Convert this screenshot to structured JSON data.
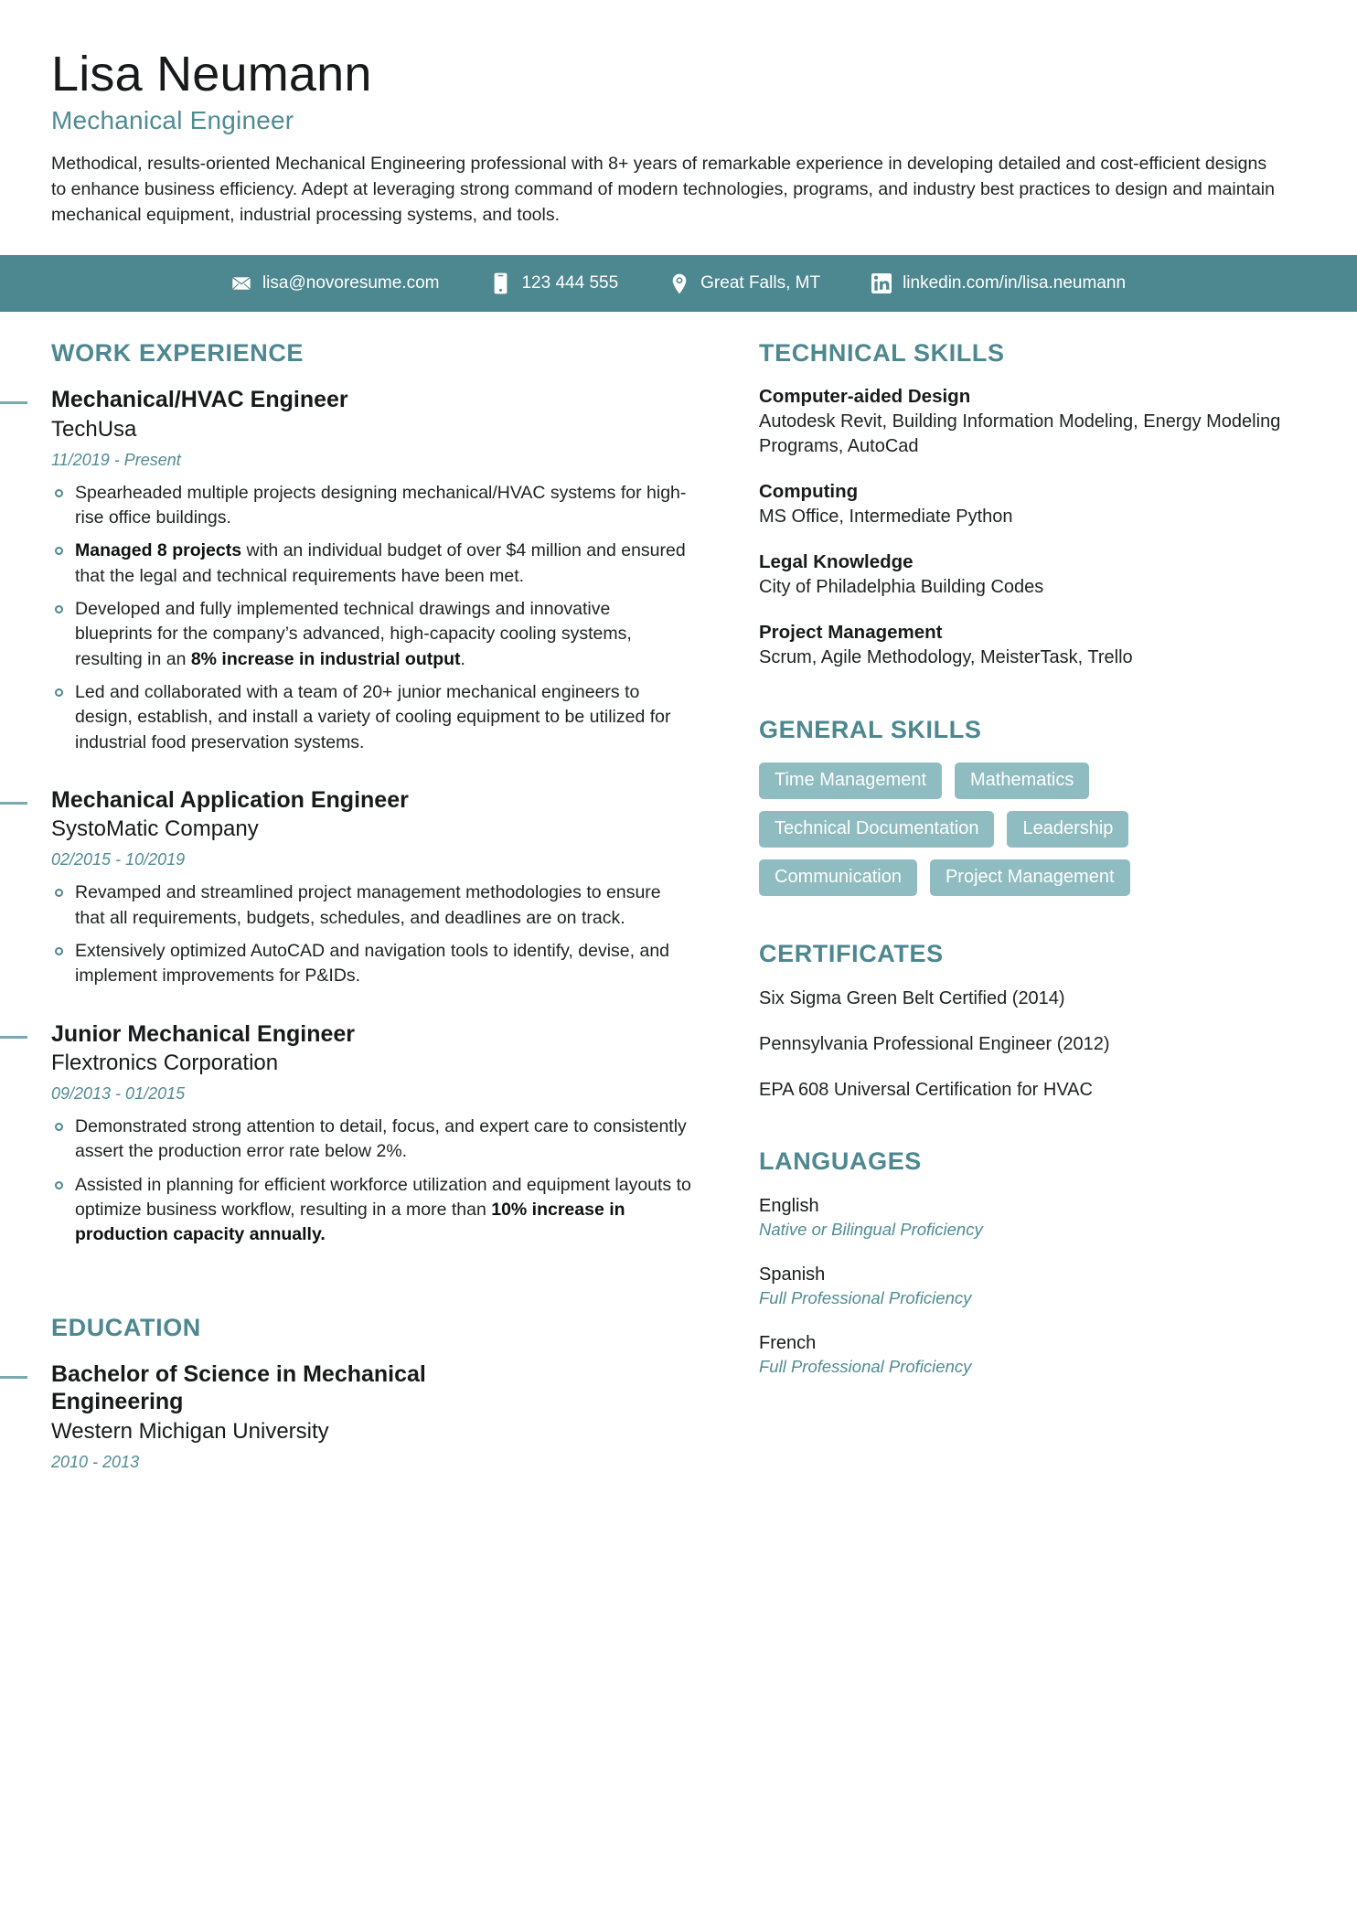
{
  "theme": {
    "accent": "#4d8790",
    "accent_light": "#8fbcc1",
    "accent_text": "#4e8c93",
    "text": "#1f2121"
  },
  "header": {
    "name": "Lisa Neumann",
    "job_title": "Mechanical Engineer",
    "summary": "Methodical, results-oriented Mechanical Engineering professional with 8+ years of remarkable experience in developing detailed and cost-efficient designs to enhance business efficiency. Adept at leveraging strong command of modern technologies, programs, and industry best practices to design and maintain mechanical equipment, industrial processing systems, and tools."
  },
  "contact": [
    {
      "icon": "email-icon",
      "value": "lisa@novoresume.com"
    },
    {
      "icon": "phone-icon",
      "value": "123 444 555"
    },
    {
      "icon": "location-pin-icon",
      "value": "Great Falls, MT"
    },
    {
      "icon": "linkedin-icon",
      "value": "linkedin.com/in/lisa.neumann"
    }
  ],
  "work_experience": {
    "title": "Work Experience",
    "entries": [
      {
        "role": "Mechanical/HVAC Engineer",
        "organization": "TechUsa",
        "date": "11/2019 - Present",
        "bullets": [
          [
            {
              "t": "Spearheaded multiple projects designing mechanical/HVAC systems for high-rise office buildings.",
              "b": false
            }
          ],
          [
            {
              "t": "Managed 8 projects",
              "b": true
            },
            {
              "t": " with an individual budget of over $4 million and ensured that the legal and technical requirements have been met.",
              "b": false
            }
          ],
          [
            {
              "t": "Developed and fully implemented technical drawings and innovative blueprints for the company’s advanced, high-capacity cooling systems, resulting in an ",
              "b": false
            },
            {
              "t": "8% increase in industrial output",
              "b": true
            },
            {
              "t": ".",
              "b": false
            }
          ],
          [
            {
              "t": "Led and collaborated with a team of 20+ junior mechanical engineers to design, establish, and install a variety of cooling equipment to be utilized for industrial food preservation systems.",
              "b": false
            }
          ]
        ]
      },
      {
        "role": "Mechanical Application Engineer",
        "organization": "SystoMatic Company",
        "date": "02/2015 - 10/2019",
        "bullets": [
          [
            {
              "t": "Revamped and streamlined project management methodologies to ensure that all requirements, budgets, schedules, and deadlines are on track.",
              "b": false
            }
          ],
          [
            {
              "t": "Extensively optimized AutoCAD and navigation tools to identify, devise, and implement improvements for P&IDs.",
              "b": false
            }
          ]
        ]
      },
      {
        "role": "Junior Mechanical Engineer",
        "organization": "Flextronics Corporation",
        "date": "09/2013 - 01/2015",
        "bullets": [
          [
            {
              "t": "Demonstrated strong attention to detail, focus, and expert care to consistently assert the production error rate below 2%.",
              "b": false
            }
          ],
          [
            {
              "t": "Assisted in planning for efficient workforce utilization and equipment layouts to optimize business workflow, resulting in a more than ",
              "b": false
            },
            {
              "t": "10% increase in production capacity annually.",
              "b": true
            }
          ]
        ]
      }
    ]
  },
  "education": {
    "title": "Education",
    "entries": [
      {
        "role": "Bachelor of Science in Mechanical Engineering",
        "organization": "Western Michigan University",
        "date": "2010 - 2013"
      }
    ]
  },
  "technical_skills": {
    "title": "Technical Skills",
    "groups": [
      {
        "name": "Computer-aided Design",
        "items": "Autodesk Revit, Building Information Modeling, Energy Modeling Programs, AutoCad"
      },
      {
        "name": "Computing",
        "items": "MS Office, Intermediate Python"
      },
      {
        "name": "Legal Knowledge",
        "items": "City of Philadelphia Building Codes"
      },
      {
        "name": "Project Management",
        "items": "Scrum, Agile Methodology, MeisterTask, Trello"
      }
    ]
  },
  "general_skills": {
    "title": "General Skills",
    "pills": [
      "Time Management",
      "Mathematics",
      "Technical Documentation",
      "Leadership",
      "Communication",
      "Project Management"
    ]
  },
  "certificates": {
    "title": "Certificates",
    "items": [
      "Six Sigma Green Belt Certified (2014)",
      "Pennsylvania Professional Engineer (2012)",
      "EPA 608 Universal Certification for HVAC"
    ]
  },
  "languages": {
    "title": "Languages",
    "items": [
      {
        "name": "English",
        "level": "Native or Bilingual Proficiency"
      },
      {
        "name": "Spanish",
        "level": "Full Professional Proficiency"
      },
      {
        "name": "French",
        "level": "Full Professional Proficiency"
      }
    ]
  }
}
